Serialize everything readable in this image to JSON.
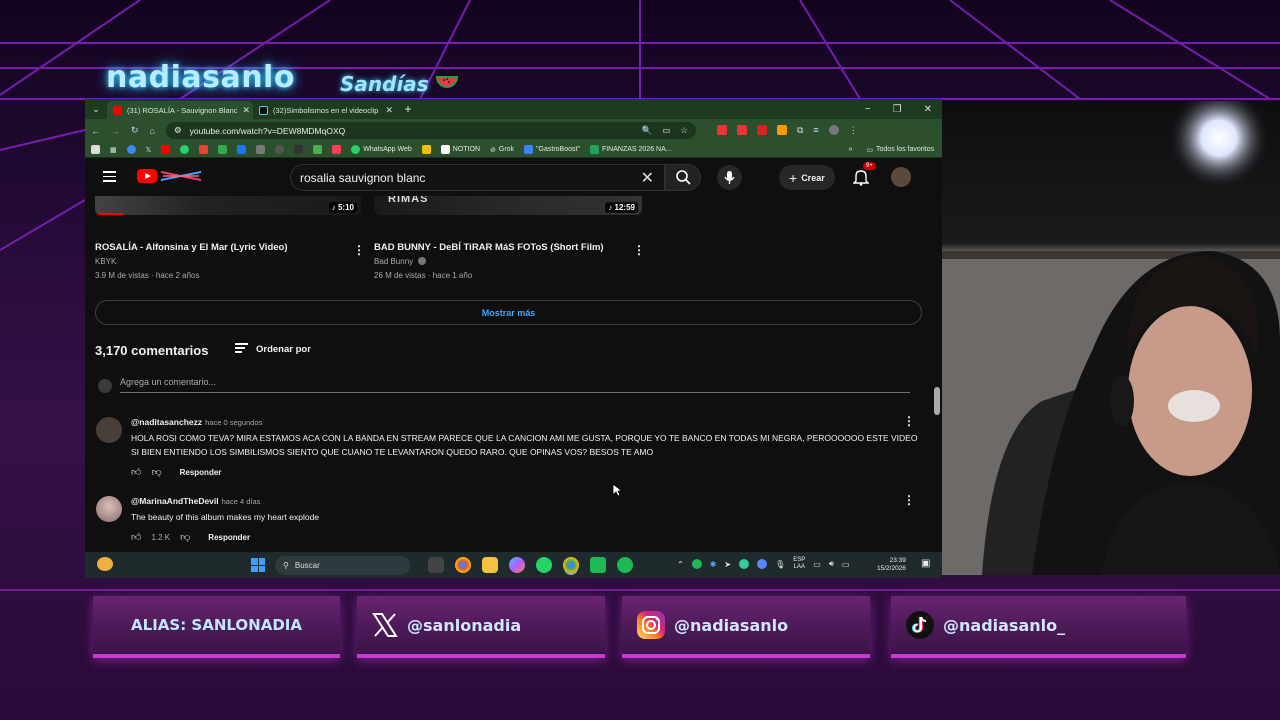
{
  "overlay": {
    "channel_name": "nadiasanlo",
    "channel_tagline": "Sandías",
    "socials": [
      {
        "platform": "alias",
        "label": "ALIAS: SANLONADIA"
      },
      {
        "platform": "x",
        "label": "@sanlonadia"
      },
      {
        "platform": "instagram",
        "label": "@nadiasanlo"
      },
      {
        "platform": "tiktok",
        "label": "@nadiasanlo_"
      }
    ]
  },
  "browser": {
    "tabs": [
      {
        "title": "(31) ROSALÍA - Sauvignon Blanc",
        "active": true
      },
      {
        "title": "(32)Simbolismos en el videoclip",
        "active": false
      }
    ],
    "url": "youtube.com/watch?v=DEW8MDMqOXQ",
    "bookmarks": [
      {
        "label": "WhatsApp Web",
        "color": "#25d366"
      },
      {
        "label": "NOTION",
        "color": "#ffffff"
      },
      {
        "label": "Grok",
        "color": "#dddddd"
      },
      {
        "label": "\"GastroBoost\"",
        "color": "#3b82f6"
      },
      {
        "label": "FINANZAS 2026 NA...",
        "color": "#22a35a"
      }
    ],
    "bookmarks_right": "Todos los favoritos"
  },
  "youtube": {
    "search_query": "rosalia sauvignon blanc",
    "create_label": "Crear",
    "notif_count": "9+",
    "videos": [
      {
        "title": "ROSALÍA - Alfonsina y El Mar (Lyric Video)",
        "channel": "KBYK",
        "meta": "3.9 M de vistas · hace 2 años",
        "duration": "5:10"
      },
      {
        "title": "BAD BUNNY - DeBÍ TiRAR MáS FOToS (Short Film)",
        "channel": "Bad Bunny",
        "meta": "26 M de vistas · hace 1 año",
        "duration": "12:59",
        "thumb_text": "RIMAS"
      }
    ],
    "show_more": "Mostrar más",
    "comments_count": "3,170 comentarios",
    "sort_label": "Ordenar por",
    "add_comment_placeholder": "Agrega un comentario...",
    "comments": [
      {
        "author": "@naditasanchezz",
        "time": "hace 0 segundos",
        "text": "HOLA ROSI COMO TEVA? MIRA ESTAMOS ACA CON LA BANDA EN STREAM PARECE QUE LA CANCION AMI ME GUSTA, PORQUE YO TE BANCO EN TODAS MI NEGRA, PEROOOOOO ESTE VIDEO SI BIEN ENTIENDO LOS SIMBILISMOS SIENTO QUE CUANO TE LEVANTARON QUEDO RARO. QUE OPINAS VOS? BESOS TE AMO",
        "likes": "",
        "reply": "Responder"
      },
      {
        "author": "@MarinaAndTheDevil",
        "time": "hace 4 días",
        "text": "The beauty of this album makes my heart explode",
        "likes": "1.2 K",
        "reply": "Responder"
      }
    ]
  },
  "taskbar": {
    "search_placeholder": "Buscar",
    "lang_top": "ESP",
    "lang_bottom": "LAA",
    "time": "23:39",
    "date": "15/2/2026"
  }
}
